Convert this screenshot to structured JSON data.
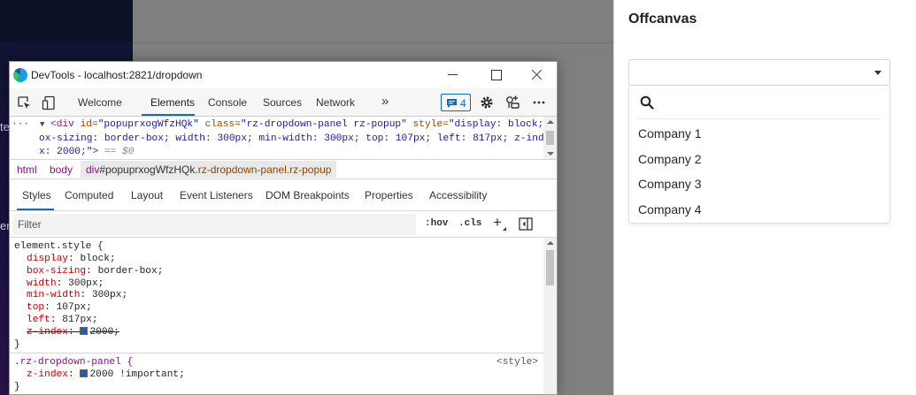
{
  "background": {
    "left_fragments": [
      "te",
      "er"
    ]
  },
  "offcanvas": {
    "title": "Offcanvas",
    "dropdown": {
      "selected": "",
      "items": [
        "Company 1",
        "Company 2",
        "Company 3",
        "Company 4"
      ]
    }
  },
  "devtools": {
    "window_title": "DevTools - localhost:2821/dropdown",
    "tabs": [
      "Welcome",
      "Elements",
      "Console",
      "Sources",
      "Network"
    ],
    "active_tab": "Elements",
    "more_tabs_glyph": "»",
    "issues_count": "4",
    "dom": {
      "dots": "···",
      "arrow": "▼",
      "line1_tag_open": "<div",
      "line1_id_attr": " id=",
      "line1_id_val": "\"popuprxogWfzHQk\"",
      "line1_class_attr": " class=",
      "line1_class_val": "\"rz-dropdown-panel rz-popup\"",
      "line1_style_attr": " style=",
      "line1_style_val": "\"display: block; b",
      "line2": "ox-sizing: border-box; width: 300px; min-width: 300px; top: 107px; left: 817px; z-inde",
      "line3_val": "x: 2000;\"",
      "line3_tag_close": ">",
      "line3_tail": " == $0"
    },
    "breadcrumbs": {
      "html": "html",
      "body": "body",
      "selected_tag": "div",
      "selected_id": "#popuprxogWfzHQk",
      "selected_class": ".rz-dropdown-panel.rz-popup"
    },
    "sub_tabs": [
      "Styles",
      "Computed",
      "Layout",
      "Event Listeners",
      "DOM Breakpoints",
      "Properties",
      "Accessibility"
    ],
    "active_sub_tab": "Styles",
    "filter": {
      "placeholder": "Filter",
      "hov": ":hov",
      "cls": ".cls",
      "plus": "+"
    },
    "styles": {
      "element_style_selector": "element.style {",
      "declarations": [
        {
          "prop": "display",
          "value": "block;"
        },
        {
          "prop": "box-sizing",
          "value": "border-box;"
        },
        {
          "prop": "width",
          "value": "300px;"
        },
        {
          "prop": "min-width",
          "value": "300px;"
        },
        {
          "prop": "top",
          "value": "107px;"
        },
        {
          "prop": "left",
          "value": "817px;"
        }
      ],
      "struck_decl": {
        "prop": "z-index",
        "value": "2000;"
      },
      "close_brace": "}",
      "rule2_selector": ".rz-dropdown-panel {",
      "rule2_source": "<style>",
      "rule2_decl": {
        "prop": "z-index",
        "value": "2000 !important;"
      },
      "rule2_close": "}"
    },
    "colors": {
      "accent": "#0f6cbd",
      "tag": "#881280",
      "property": "#c80000",
      "swatch": "#1f5fad"
    }
  }
}
